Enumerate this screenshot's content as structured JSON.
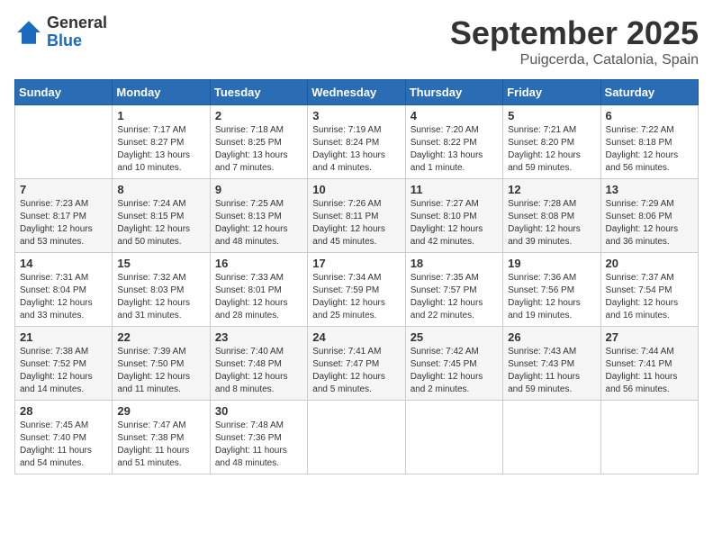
{
  "logo": {
    "general": "General",
    "blue": "Blue"
  },
  "title": "September 2025",
  "location": "Puigcerda, Catalonia, Spain",
  "weekdays": [
    "Sunday",
    "Monday",
    "Tuesday",
    "Wednesday",
    "Thursday",
    "Friday",
    "Saturday"
  ],
  "weeks": [
    [
      null,
      {
        "day": 1,
        "sunrise": "7:17 AM",
        "sunset": "8:27 PM",
        "daylight": "13 hours and 10 minutes."
      },
      {
        "day": 2,
        "sunrise": "7:18 AM",
        "sunset": "8:25 PM",
        "daylight": "13 hours and 7 minutes."
      },
      {
        "day": 3,
        "sunrise": "7:19 AM",
        "sunset": "8:24 PM",
        "daylight": "13 hours and 4 minutes."
      },
      {
        "day": 4,
        "sunrise": "7:20 AM",
        "sunset": "8:22 PM",
        "daylight": "13 hours and 1 minute."
      },
      {
        "day": 5,
        "sunrise": "7:21 AM",
        "sunset": "8:20 PM",
        "daylight": "12 hours and 59 minutes."
      },
      {
        "day": 6,
        "sunrise": "7:22 AM",
        "sunset": "8:18 PM",
        "daylight": "12 hours and 56 minutes."
      }
    ],
    [
      {
        "day": 7,
        "sunrise": "7:23 AM",
        "sunset": "8:17 PM",
        "daylight": "12 hours and 53 minutes."
      },
      {
        "day": 8,
        "sunrise": "7:24 AM",
        "sunset": "8:15 PM",
        "daylight": "12 hours and 50 minutes."
      },
      {
        "day": 9,
        "sunrise": "7:25 AM",
        "sunset": "8:13 PM",
        "daylight": "12 hours and 48 minutes."
      },
      {
        "day": 10,
        "sunrise": "7:26 AM",
        "sunset": "8:11 PM",
        "daylight": "12 hours and 45 minutes."
      },
      {
        "day": 11,
        "sunrise": "7:27 AM",
        "sunset": "8:10 PM",
        "daylight": "12 hours and 42 minutes."
      },
      {
        "day": 12,
        "sunrise": "7:28 AM",
        "sunset": "8:08 PM",
        "daylight": "12 hours and 39 minutes."
      },
      {
        "day": 13,
        "sunrise": "7:29 AM",
        "sunset": "8:06 PM",
        "daylight": "12 hours and 36 minutes."
      }
    ],
    [
      {
        "day": 14,
        "sunrise": "7:31 AM",
        "sunset": "8:04 PM",
        "daylight": "12 hours and 33 minutes."
      },
      {
        "day": 15,
        "sunrise": "7:32 AM",
        "sunset": "8:03 PM",
        "daylight": "12 hours and 31 minutes."
      },
      {
        "day": 16,
        "sunrise": "7:33 AM",
        "sunset": "8:01 PM",
        "daylight": "12 hours and 28 minutes."
      },
      {
        "day": 17,
        "sunrise": "7:34 AM",
        "sunset": "7:59 PM",
        "daylight": "12 hours and 25 minutes."
      },
      {
        "day": 18,
        "sunrise": "7:35 AM",
        "sunset": "7:57 PM",
        "daylight": "12 hours and 22 minutes."
      },
      {
        "day": 19,
        "sunrise": "7:36 AM",
        "sunset": "7:56 PM",
        "daylight": "12 hours and 19 minutes."
      },
      {
        "day": 20,
        "sunrise": "7:37 AM",
        "sunset": "7:54 PM",
        "daylight": "12 hours and 16 minutes."
      }
    ],
    [
      {
        "day": 21,
        "sunrise": "7:38 AM",
        "sunset": "7:52 PM",
        "daylight": "12 hours and 14 minutes."
      },
      {
        "day": 22,
        "sunrise": "7:39 AM",
        "sunset": "7:50 PM",
        "daylight": "12 hours and 11 minutes."
      },
      {
        "day": 23,
        "sunrise": "7:40 AM",
        "sunset": "7:48 PM",
        "daylight": "12 hours and 8 minutes."
      },
      {
        "day": 24,
        "sunrise": "7:41 AM",
        "sunset": "7:47 PM",
        "daylight": "12 hours and 5 minutes."
      },
      {
        "day": 25,
        "sunrise": "7:42 AM",
        "sunset": "7:45 PM",
        "daylight": "12 hours and 2 minutes."
      },
      {
        "day": 26,
        "sunrise": "7:43 AM",
        "sunset": "7:43 PM",
        "daylight": "11 hours and 59 minutes."
      },
      {
        "day": 27,
        "sunrise": "7:44 AM",
        "sunset": "7:41 PM",
        "daylight": "11 hours and 56 minutes."
      }
    ],
    [
      {
        "day": 28,
        "sunrise": "7:45 AM",
        "sunset": "7:40 PM",
        "daylight": "11 hours and 54 minutes."
      },
      {
        "day": 29,
        "sunrise": "7:47 AM",
        "sunset": "7:38 PM",
        "daylight": "11 hours and 51 minutes."
      },
      {
        "day": 30,
        "sunrise": "7:48 AM",
        "sunset": "7:36 PM",
        "daylight": "11 hours and 48 minutes."
      },
      null,
      null,
      null,
      null
    ]
  ]
}
